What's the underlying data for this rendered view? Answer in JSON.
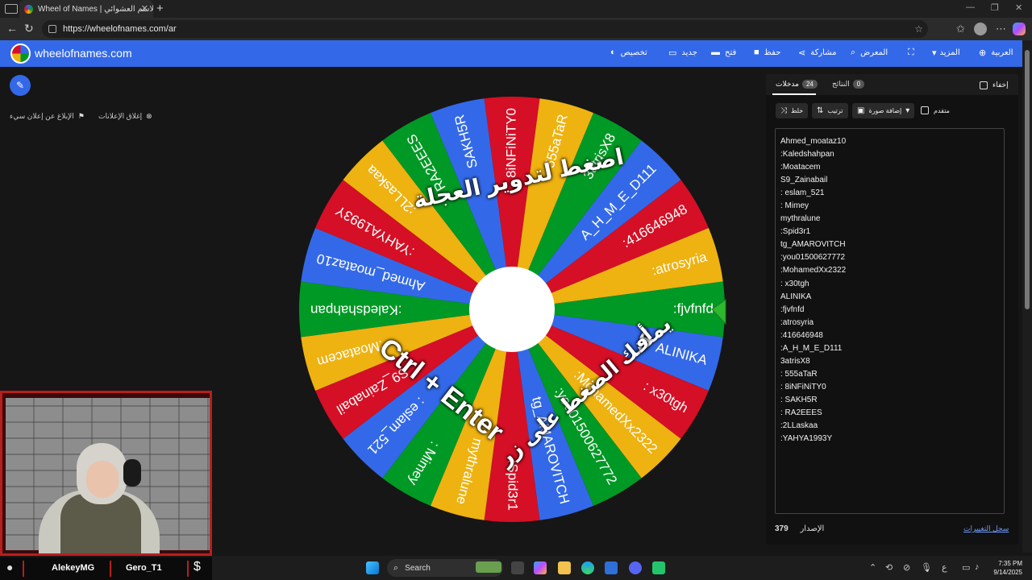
{
  "browser": {
    "tab_title": "Wheel of Names | الاسم العشوائي",
    "url": "https://wheelofnames.com/ar"
  },
  "site": {
    "logo_text": "wheelofnames.com",
    "menu": {
      "customize": "تخصيص",
      "new": "جديد",
      "open": "فتح",
      "save": "حفظ",
      "share": "مشاركة",
      "gallery": "المعرض",
      "more": "المزيد",
      "language": "العربية"
    }
  },
  "ads": {
    "close_ads": "إغلاق الإعلانات",
    "report_ad": "الإبلاغ عن إعلان سيء"
  },
  "wheel": {
    "overlay_spin": "اضغط لتدوير العجلة",
    "overlay_or": "أو",
    "overlay_press": "يمكنك الضغط على زر",
    "overlay_keys": "Ctrl + Enter",
    "colors": [
      "#3369e8",
      "#d50f25",
      "#eeb211",
      "#009925"
    ],
    "segments": [
      "SAKH5R",
      "8iNFiNiTY0",
      "555aTaR",
      "3atrisX8",
      "A_H_M_E_D111",
      ":416646948",
      ":atrosyria",
      ":fjvfnfd",
      "ALINIKA",
      ": x30tgh",
      ":MohamedXx2322",
      ":you01500627772",
      "tg_AMAROVITCH",
      ":Spid3r1",
      "mythralune",
      ": Mimey",
      ": eslam_521",
      "S9_Zainabail",
      ":Moatacem",
      ":Kaledshahpan",
      "Ahmed_moataz10",
      ":YAHYA1993Y",
      ":2LLaskaa",
      ": RA2EEES"
    ]
  },
  "panel": {
    "tab_entries": "مدخلات",
    "entries_count": "24",
    "tab_results": "النتائج",
    "results_count": "0",
    "hide_label": "إخفاء",
    "shuffle": "خلط",
    "sort": "ترتيب",
    "add_image": "إضافة صورة",
    "advanced": "متقدم",
    "entries": [
      "Ahmed_moataz10",
      ":Kaledshahpan",
      ":Moatacem",
      "S9_Zainabail",
      ": eslam_521",
      ": Mimey",
      "mythralune",
      ":Spid3r1",
      "tg_AMAROVITCH",
      ":you01500627772",
      ":MohamedXx2322",
      ": x30tgh",
      "ALINIKA",
      ":fjvfnfd",
      ":atrosyria",
      ":416646948",
      ":A_H_M_E_D111",
      "3atrisX8",
      ": 555aTaR",
      ": 8iNFiNiTY0",
      ": SAKH5R",
      ": RA2EEES",
      ":2LLaskaa",
      ":YAHYA1993Y"
    ],
    "version_label": "الإصدار",
    "version_number": "379",
    "changelog": "سجل التغييرات"
  },
  "webcam": {
    "name_left": "AlekeyMG",
    "name_right": "Gero_T1"
  },
  "taskbar": {
    "search_label": "Search",
    "time": "7:35 PM",
    "date": "9/14/2025",
    "lang": "ع"
  }
}
